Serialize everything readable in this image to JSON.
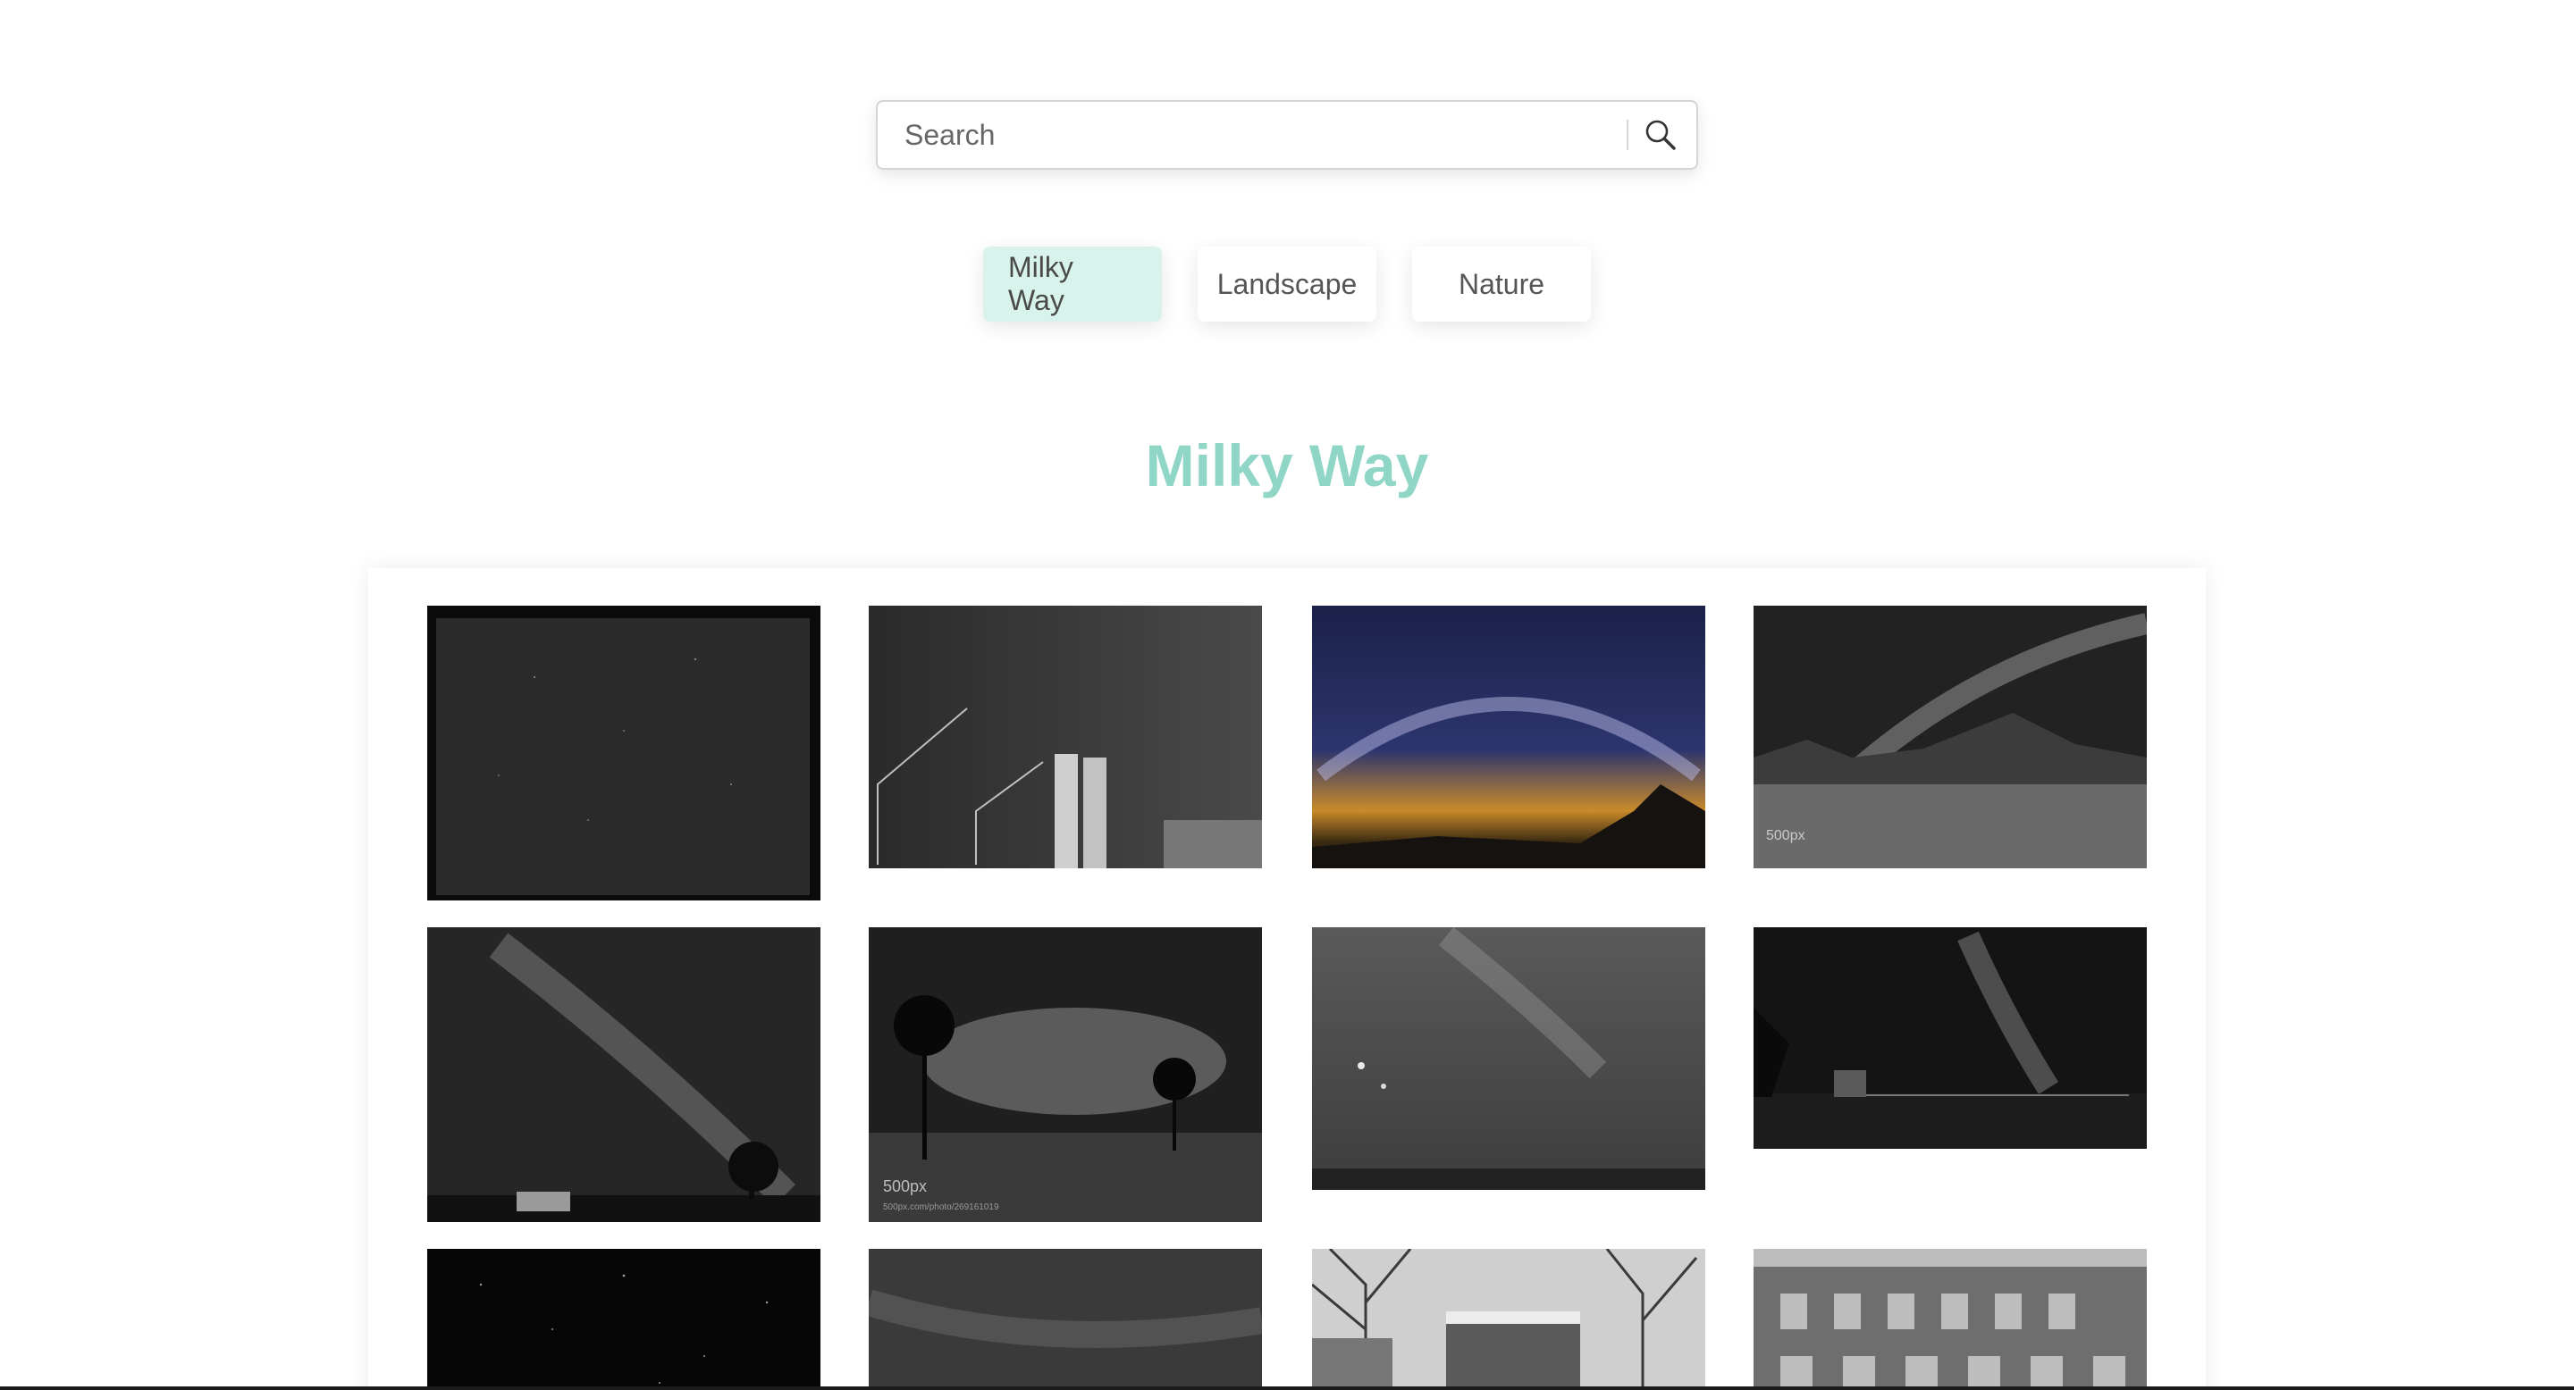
{
  "search": {
    "placeholder": "Search",
    "value": ""
  },
  "icons": {
    "search": "search-icon"
  },
  "categories": [
    {
      "label": "Milky Way",
      "active": true
    },
    {
      "label": "Landscape",
      "active": false
    },
    {
      "label": "Nature",
      "active": false
    }
  ],
  "section": {
    "title": "Milky Way"
  },
  "watermarks": {
    "brand": "500px",
    "url": "500px.com/photo/269161019"
  },
  "colors": {
    "accent": "#8fd6c6",
    "active_pill": "#d8f2ec",
    "text": "#555555"
  }
}
